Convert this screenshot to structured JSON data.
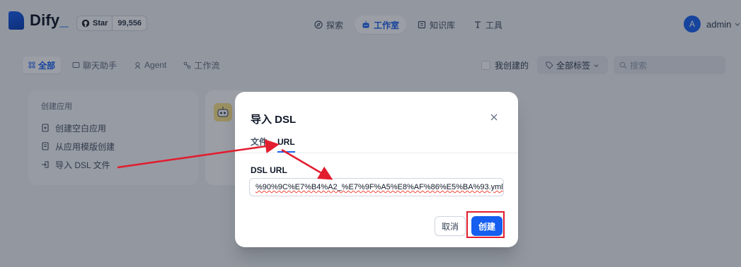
{
  "brand": {
    "name": "Dify",
    "suffix": "_",
    "accent": "#1c64f2"
  },
  "github": {
    "star_label": "Star",
    "star_count": "99,556"
  },
  "nav": [
    {
      "label": "探索",
      "icon": "compass-icon",
      "active": false
    },
    {
      "label": "工作室",
      "icon": "robot-icon",
      "active": true
    },
    {
      "label": "知识库",
      "icon": "book-icon",
      "active": false
    },
    {
      "label": "工具",
      "icon": "tool-icon",
      "active": false
    }
  ],
  "user": {
    "avatar_letter": "A",
    "name": "admin"
  },
  "filter_tabs": [
    {
      "label": "全部",
      "icon": "grid-icon",
      "active": true
    },
    {
      "label": "聊天助手",
      "icon": "chat-icon",
      "active": false
    },
    {
      "label": "Agent",
      "icon": "agent-icon",
      "active": false
    },
    {
      "label": "工作流",
      "icon": "workflow-icon",
      "active": false
    }
  ],
  "filters": {
    "mine_label": "我创建的",
    "tags_label": "全部标签",
    "search_placeholder": "搜索"
  },
  "create_card": {
    "title": "创建应用",
    "items": [
      {
        "label": "创建空白应用",
        "icon": "file-plus-icon"
      },
      {
        "label": "从应用模版创建",
        "icon": "template-icon"
      },
      {
        "label": "导入 DSL 文件",
        "icon": "import-icon"
      }
    ]
  },
  "modal": {
    "title": "导入 DSL",
    "tabs": [
      {
        "label": "文件",
        "active": false
      },
      {
        "label": "URL",
        "active": true
      }
    ],
    "field_label": "DSL URL",
    "url_value": "%90%9C%E7%B4%A2_%E7%9F%A5%E8%AF%86%E5%BA%93.yml",
    "cancel_label": "取消",
    "create_label": "创建"
  },
  "annotation_colors": {
    "arrow": "#e11d2f",
    "primary_button": "#155eef"
  }
}
